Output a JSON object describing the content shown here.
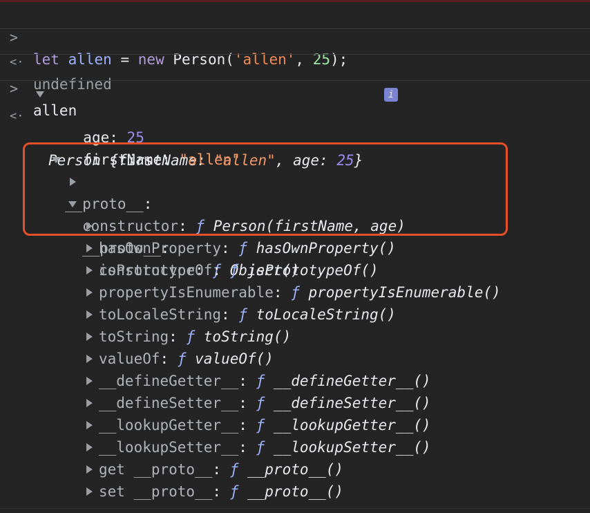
{
  "console": {
    "input1": {
      "kw_let": "let",
      "var_name": "allen",
      "op_eq": "=",
      "kw_new": "new",
      "ctor": "Person(",
      "str_arg": "'allen'",
      "comma": ",",
      "num_arg": "25",
      "close": ");"
    },
    "output1": "undefined",
    "input2": "allen",
    "result": {
      "header_name": "Person",
      "header_open": "{",
      "header_k1": "firstName",
      "header_colon1": ":",
      "header_v1": "\"allen\"",
      "header_comma": ",",
      "header_k2": "age",
      "header_colon2": ":",
      "header_v2": "25",
      "header_close": "}",
      "info_badge": "i",
      "age_key": "age",
      "age_value": "25",
      "firstName_key": "firstName",
      "firstName_value": "\"allen\"",
      "proto_key": "__proto__",
      "proto_constructor_key": "constructor",
      "proto_constructor_value": "Person(firstName, age)",
      "inner_proto_key": "__proto__",
      "inner_constructor_key": "constructor",
      "inner_constructor_value": "Object()",
      "f_symbol": "ƒ",
      "colon": ":",
      "methods": [
        {
          "key": "hasOwnProperty",
          "value": "hasOwnProperty()"
        },
        {
          "key": "isPrototypeOf",
          "value": "isPrototypeOf()"
        },
        {
          "key": "propertyIsEnumerable",
          "value": "propertyIsEnumerable()"
        },
        {
          "key": "toLocaleString",
          "value": "toLocaleString()"
        },
        {
          "key": "toString",
          "value": "toString()"
        },
        {
          "key": "valueOf",
          "value": "valueOf()"
        },
        {
          "key": "__defineGetter__",
          "value": "__defineGetter__()"
        },
        {
          "key": "__defineSetter__",
          "value": "__defineSetter__()"
        },
        {
          "key": "__lookupGetter__",
          "value": "__lookupGetter__()"
        },
        {
          "key": "__lookupSetter__",
          "value": "__lookupSetter__()"
        },
        {
          "key": "get __proto__",
          "value": "__proto__()"
        },
        {
          "key": "set __proto__",
          "value": "__proto__()"
        }
      ]
    },
    "prompt_symbol": ">",
    "return_symbol": "<·"
  },
  "colors": {
    "background": "#242424",
    "highlight_border": "#e4502a",
    "keyword": "#b39ddb",
    "string": "#f28b54",
    "number": "#9d8cf0"
  }
}
